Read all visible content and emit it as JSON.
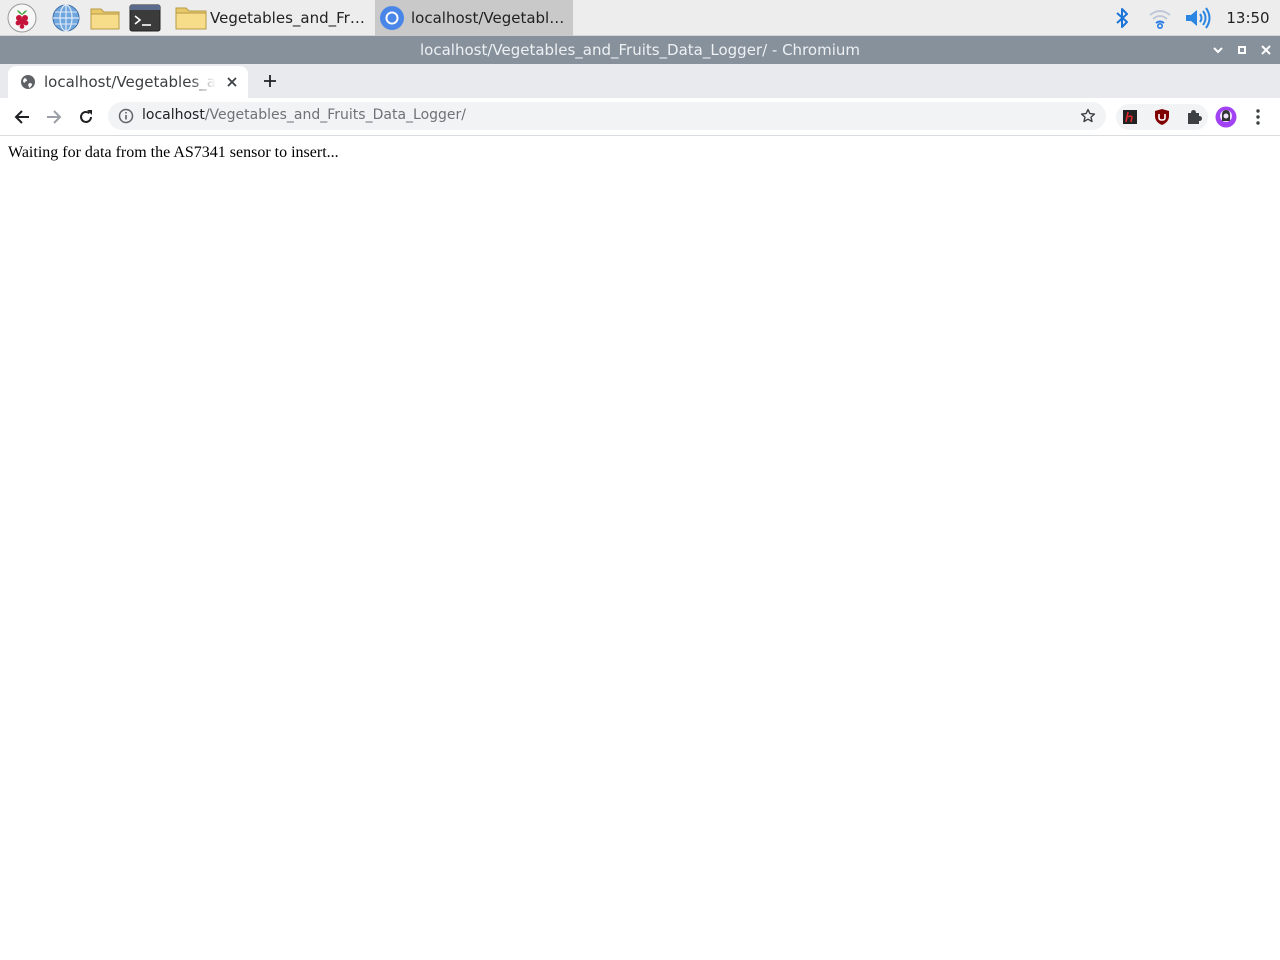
{
  "taskbar": {
    "tasks": [
      {
        "label": "Vegetables_and_Fruit..."
      },
      {
        "label": "localhost/Vegetables..."
      }
    ],
    "clock": "13:50"
  },
  "window": {
    "title": "localhost/Vegetables_and_Fruits_Data_Logger/ - Chromium"
  },
  "tabs": [
    {
      "title": "localhost/Vegetables_and_Fruits_Data_Logger/"
    }
  ],
  "omnibox": {
    "host": "localhost",
    "path": "/Vegetables_and_Fruits_Data_Logger/"
  },
  "page": {
    "message": "Waiting for data from the AS7341 sensor to insert..."
  },
  "colors": {
    "accent": "#1a73e8",
    "titlebar": "#87919b",
    "tab_strip": "#e8eaed"
  },
  "icons": {
    "menu": "raspberry-icon",
    "browser": "globe-icon",
    "files": "folder-icon",
    "terminal": "terminal-icon",
    "bluetooth": "bluetooth-icon",
    "wifi": "wifi-icon",
    "volume": "volume-icon"
  }
}
